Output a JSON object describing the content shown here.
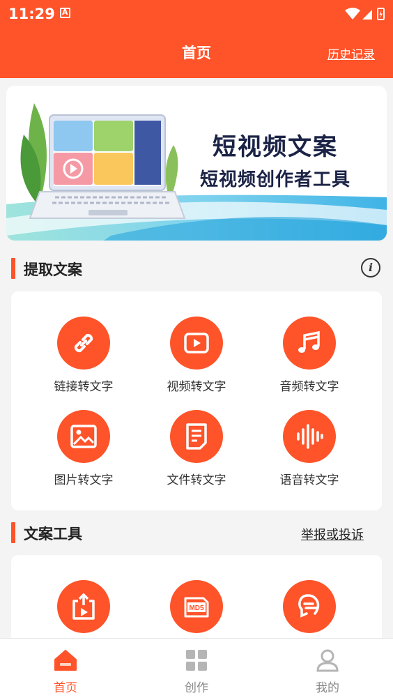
{
  "status_bar": {
    "time": "11:29",
    "notification_letter": "A"
  },
  "header": {
    "title": "首页",
    "history_label": "历史记录"
  },
  "banner": {
    "title": "短视频文案",
    "subtitle": "短视频创作者工具"
  },
  "extract_section": {
    "title": "提取文案",
    "tools": [
      {
        "label": "链接转文字",
        "icon": "link-icon"
      },
      {
        "label": "视频转文字",
        "icon": "video-icon"
      },
      {
        "label": "音频转文字",
        "icon": "music-icon"
      },
      {
        "label": "图片转文字",
        "icon": "image-icon"
      },
      {
        "label": "文件转文字",
        "icon": "document-icon"
      },
      {
        "label": "语音转文字",
        "icon": "voice-wave-icon"
      }
    ]
  },
  "tools_section": {
    "title": "文案工具",
    "report_label": "举报或投诉",
    "tools": [
      {
        "icon": "share-video-icon"
      },
      {
        "icon": "md5-icon"
      },
      {
        "icon": "speech-icon"
      }
    ]
  },
  "bottom_nav": {
    "items": [
      {
        "label": "首页",
        "icon": "home-icon",
        "active": true
      },
      {
        "label": "创作",
        "icon": "grid-icon",
        "active": false
      },
      {
        "label": "我的",
        "icon": "profile-icon",
        "active": false
      }
    ]
  },
  "colors": {
    "accent": "#ff5329",
    "background": "#f4f4f4",
    "banner_text": "#1b2346"
  }
}
